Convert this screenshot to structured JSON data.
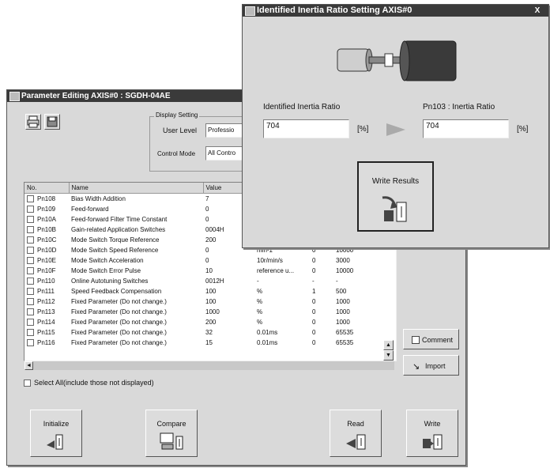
{
  "param_window": {
    "title": "Parameter Editing AXIS#0 : SGDH-04AE",
    "display_setting": {
      "legend": "Display Setting",
      "user_level_label": "User Level",
      "user_level_value": "Professio",
      "control_mode_label": "Control Mode",
      "control_mode_value": "All Contro"
    },
    "table": {
      "headers": [
        "No.",
        "Name",
        "Value"
      ],
      "rows": [
        {
          "no": "Pn108",
          "name": "Bias Width Addition",
          "value": "7",
          "unit": "",
          "c5": "",
          "c6": ""
        },
        {
          "no": "Pn109",
          "name": "Feed-forward",
          "value": "0",
          "unit": "",
          "c5": "",
          "c6": ""
        },
        {
          "no": "Pn10A",
          "name": "Feed-forward Filter Time Constant",
          "value": "0",
          "unit": "",
          "c5": "",
          "c6": ""
        },
        {
          "no": "Pn10B",
          "name": "Gain-related Application Switches",
          "value": "0004H",
          "unit": "",
          "c5": "",
          "c6": ""
        },
        {
          "no": "Pn10C",
          "name": "Mode Switch Torque Reference",
          "value": "200",
          "unit": "",
          "c5": "",
          "c6": ""
        },
        {
          "no": "Pn10D",
          "name": "Mode Switch Speed Reference",
          "value": "0",
          "unit": "min-1",
          "c5": "0",
          "c6": "10000"
        },
        {
          "no": "Pn10E",
          "name": "Mode Switch Acceleration",
          "value": "0",
          "unit": "10r/min/s",
          "c5": "0",
          "c6": "3000"
        },
        {
          "no": "Pn10F",
          "name": "Mode Switch Error Pulse",
          "value": "10",
          "unit": "reference u...",
          "c5": "0",
          "c6": "10000"
        },
        {
          "no": "Pn110",
          "name": "Online Autotuning Switches",
          "value": "0012H",
          "unit": "-",
          "c5": "-",
          "c6": "-"
        },
        {
          "no": "Pn111",
          "name": "Speed Feedback Compensation",
          "value": "100",
          "unit": "%",
          "c5": "1",
          "c6": "500"
        },
        {
          "no": "Pn112",
          "name": "Fixed Parameter (Do not change.)",
          "value": "100",
          "unit": "%",
          "c5": "0",
          "c6": "1000"
        },
        {
          "no": "Pn113",
          "name": "Fixed Parameter (Do not change.)",
          "value": "1000",
          "unit": "%",
          "c5": "0",
          "c6": "1000"
        },
        {
          "no": "Pn114",
          "name": "Fixed Parameter (Do not change.)",
          "value": "200",
          "unit": "%",
          "c5": "0",
          "c6": "1000"
        },
        {
          "no": "Pn115",
          "name": "Fixed Parameter (Do not change.)",
          "value": "32",
          "unit": "0.01ms",
          "c5": "0",
          "c6": "65535"
        },
        {
          "no": "Pn116",
          "name": "Fixed Parameter (Do not change.)",
          "value": "15",
          "unit": "0.01ms",
          "c5": "0",
          "c6": "65535"
        }
      ]
    },
    "select_all_label": "Select All(include those not displayed)",
    "comment_label": "Comment",
    "import_label": "Import",
    "initialize_label": "Initialize",
    "compare_label": "Compare",
    "read_label": "Read",
    "write_label": "Write"
  },
  "inertia_window": {
    "title": "Identified Inertia Ratio Setting AXIS#0",
    "close_glyph": "X",
    "identified_label": "Identified Inertia Ratio",
    "identified_value": "704",
    "identified_unit": "[%]",
    "pn103_label": "Pn103 : Inertia Ratio",
    "pn103_value": "704",
    "pn103_unit": "[%]",
    "write_results_label": "Write Results"
  }
}
